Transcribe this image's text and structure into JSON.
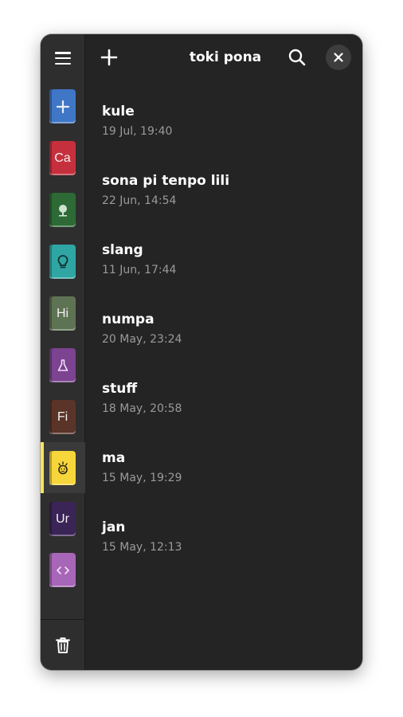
{
  "header": {
    "title": "toki pona",
    "add_icon": "plus-icon",
    "search_icon": "search-icon",
    "close_icon": "close-icon",
    "menu_icon": "hamburger-menu-icon"
  },
  "sidebar": {
    "notebooks": [
      {
        "label": "",
        "icon": "plus-icon",
        "color": "#3f76c6"
      },
      {
        "label": "Ca",
        "icon": "",
        "color": "#c6303d"
      },
      {
        "label": "",
        "icon": "tree-icon",
        "color": "#2e6a36"
      },
      {
        "label": "",
        "icon": "lightbulb-icon",
        "color": "#2fa6a4"
      },
      {
        "label": "Hi",
        "icon": "",
        "color": "#5e7353"
      },
      {
        "label": "",
        "icon": "flask-icon",
        "color": "#7c4391"
      },
      {
        "label": "Fi",
        "icon": "",
        "color": "#5a3428"
      },
      {
        "label": "",
        "icon": "sun-face-icon",
        "color": "#f6d63a",
        "selected": true
      },
      {
        "label": "Ur",
        "icon": "",
        "color": "#3b2456"
      },
      {
        "label": "",
        "icon": "code-icon",
        "color": "#a866b8"
      }
    ],
    "trash_icon": "trash-icon"
  },
  "notes": [
    {
      "title": "kule",
      "date": "19 Jul, 19:40"
    },
    {
      "title": "sona pi tenpo lili",
      "date": "22 Jun, 14:54"
    },
    {
      "title": "slang",
      "date": "11 Jun, 17:44"
    },
    {
      "title": "numpa",
      "date": "20 May, 23:24"
    },
    {
      "title": "stuff",
      "date": "18 May, 20:58"
    },
    {
      "title": "ma",
      "date": "15 May, 19:29"
    },
    {
      "title": "jan",
      "date": "15 May, 12:13"
    }
  ],
  "colors": {
    "window_bg": "#242424",
    "sidebar_bg": "#2e2e2e",
    "selected_accent": "#f8e45c"
  }
}
